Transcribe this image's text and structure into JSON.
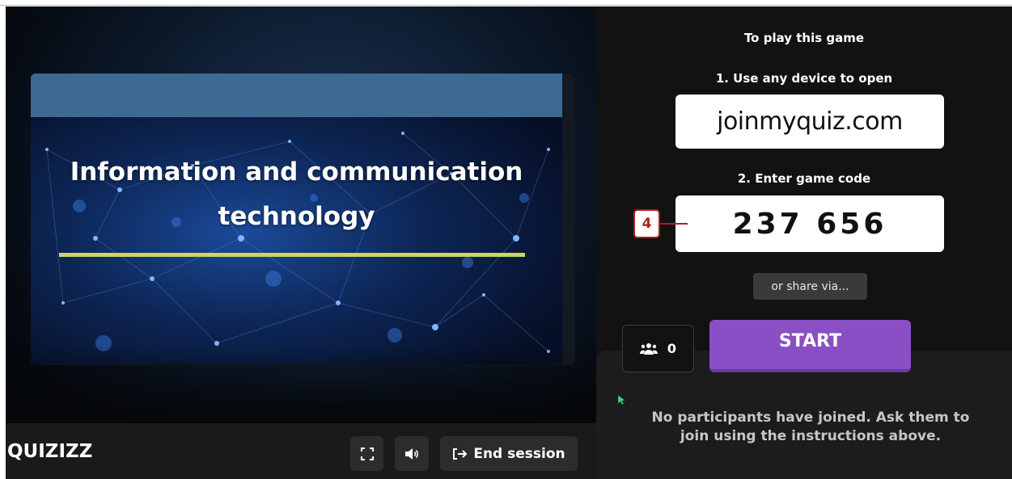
{
  "slide": {
    "title_line1": "Information and communication",
    "title_line2": "technology"
  },
  "footer": {
    "brand": "QUIZIZZ",
    "end_session_label": "End session"
  },
  "join": {
    "heading": "To play this game",
    "step1": "1. Use any device to open",
    "url": "joinmyquiz.com",
    "step2": "2. Enter game code",
    "game_code": "237 656",
    "share_label": "or share via...",
    "participant_count": "0",
    "start_label": "START",
    "empty_message": "No participants have joined. Ask them to join using the instructions above."
  },
  "annotation": {
    "marker_number": "4",
    "marker_color": "#b01e1e"
  },
  "colors": {
    "start_button": "#8a4fc4",
    "slide_header": "#3c6a93",
    "slide_underline": "#cbd563"
  },
  "icons": {
    "fullscreen": "fullscreen-icon",
    "volume": "volume-icon",
    "end_session": "exit-icon",
    "participants": "users-icon",
    "cursor": "mouse-cursor-icon"
  }
}
